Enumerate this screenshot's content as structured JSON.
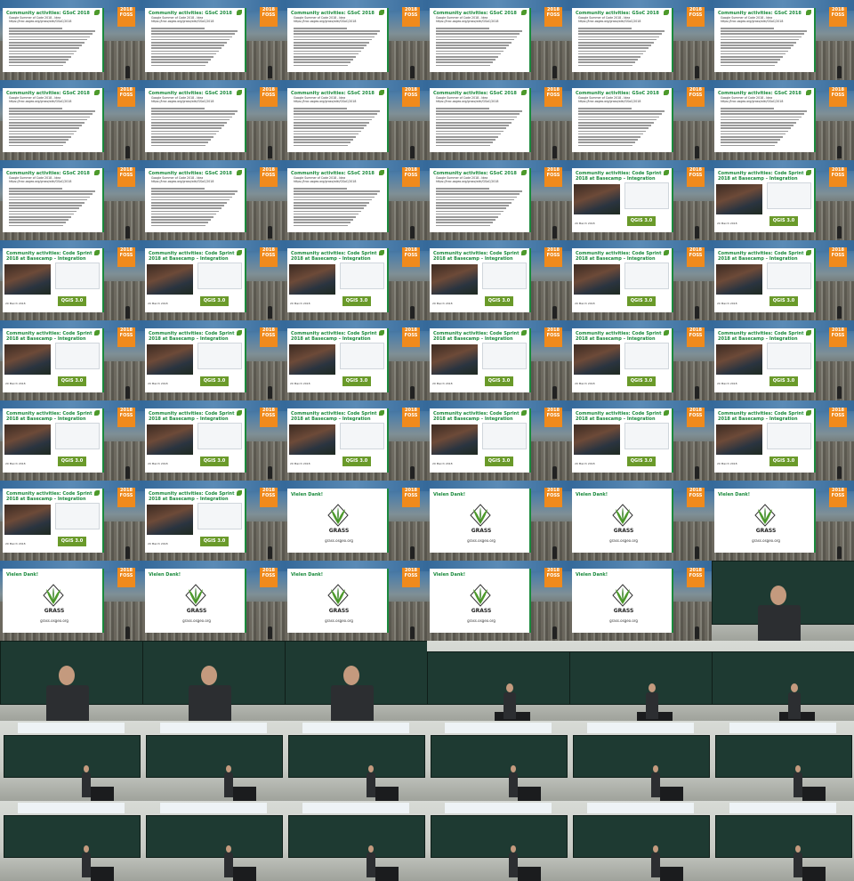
{
  "gsoc": {
    "title": "Community activities: GSoC 2018",
    "line1": "Google Summer of Code 2018 - Idea",
    "line2": "https://trac.osgeo.org/grass/wiki/GSoC/2018"
  },
  "sprint": {
    "title": "Community activities: Code Sprint 2018 at Basecamp – Integration",
    "qgis": "QGIS 3.0",
    "date": "20 March 2018"
  },
  "dank": {
    "title": "Vielen Dank!",
    "logo": "GRASS",
    "url": "grass.osgeo.org"
  },
  "logo": {
    "year": "2018",
    "name": "FOSS"
  },
  "colors": {
    "green": "#1a8a3c",
    "orange": "#f08a1c",
    "board": "#1e3a32"
  },
  "rows": [
    [
      "gsoc",
      "gsoc",
      "gsoc",
      "gsoc",
      "gsoc",
      "gsoc"
    ],
    [
      "gsoc",
      "gsoc",
      "gsoc",
      "gsoc",
      "gsoc",
      "gsoc"
    ],
    [
      "gsoc",
      "gsoc",
      "gsoc",
      "gsoc",
      "sprint",
      "sprint"
    ],
    [
      "sprint",
      "sprint",
      "sprint",
      "sprint",
      "sprint",
      "sprint"
    ],
    [
      "sprint",
      "sprint",
      "sprint",
      "sprint",
      "sprint",
      "sprint"
    ],
    [
      "sprint",
      "sprint",
      "sprint",
      "sprint",
      "sprint",
      "sprint"
    ],
    [
      "sprint",
      "sprint",
      "dank",
      "dank",
      "dank",
      "dank"
    ],
    [
      "dank",
      "dank",
      "dank",
      "dank",
      "dank",
      "hall-closeup"
    ],
    [
      "hall-closeup",
      "hall-closeup",
      "hall-closeup",
      "hall-mid",
      "hall-mid",
      "hall-mid"
    ],
    [
      "hall-wide",
      "hall-wide",
      "hall-wide",
      "hall-wide",
      "hall-wide",
      "hall-wide"
    ],
    [
      "hall-wide",
      "hall-wide",
      "hall-wide",
      "hall-wide",
      "hall-wide",
      "hall-wide"
    ]
  ]
}
